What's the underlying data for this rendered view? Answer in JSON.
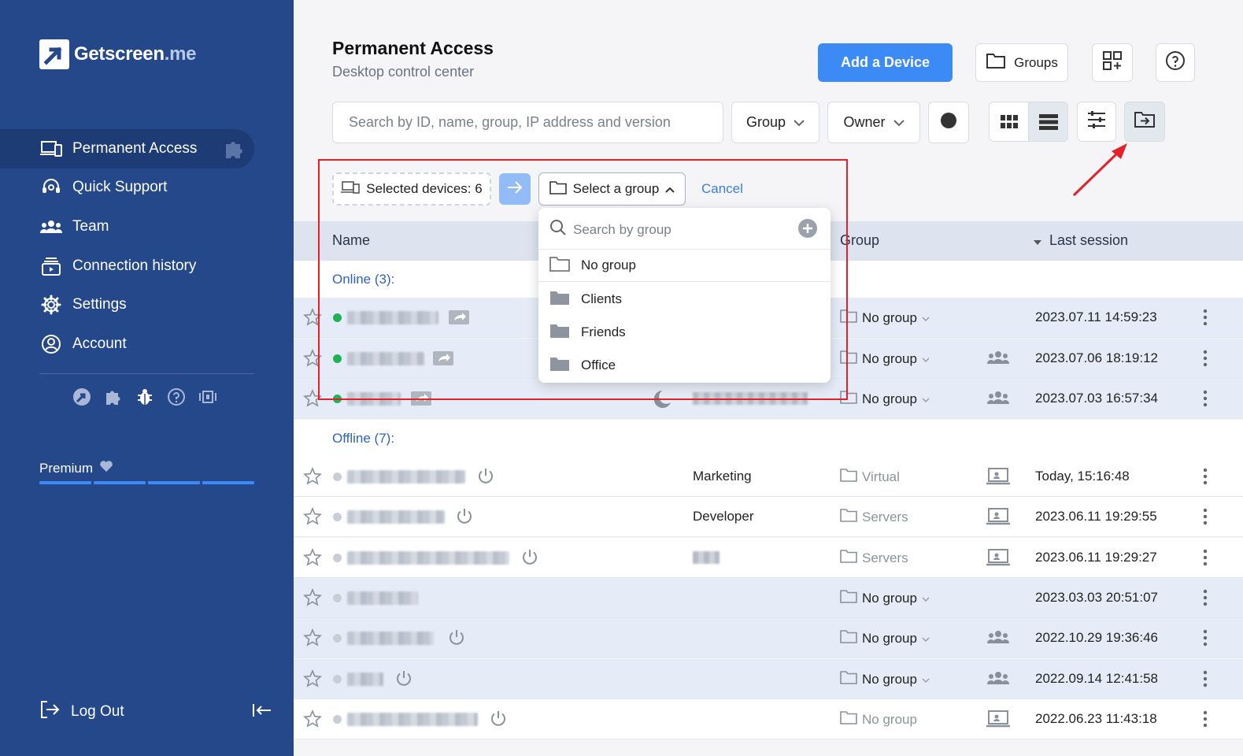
{
  "brand": {
    "name": "Getscreen",
    "suffix": ".me"
  },
  "sidebar": {
    "items": [
      {
        "label": "Permanent Access",
        "icon": "devices-icon",
        "active": true
      },
      {
        "label": "Quick Support",
        "icon": "headset-icon"
      },
      {
        "label": "Team",
        "icon": "team-icon"
      },
      {
        "label": "Connection history",
        "icon": "history-icon"
      },
      {
        "label": "Settings",
        "icon": "gear-icon"
      },
      {
        "label": "Account",
        "icon": "account-icon"
      }
    ],
    "tools": [
      "app-logo-icon",
      "puzzle-icon",
      "bug-icon",
      "help-circle-icon",
      "flag-icon"
    ],
    "plan": "Premium",
    "logout": "Log Out"
  },
  "header": {
    "title": "Permanent Access",
    "subtitle": "Desktop control center",
    "add_device": "Add a Device",
    "groups": "Groups"
  },
  "filters": {
    "search_placeholder": "Search by ID, name, group, IP address and version",
    "group": "Group",
    "owner": "Owner"
  },
  "selection": {
    "count_label": "Selected devices: 6",
    "select_group": "Select a group",
    "cancel": "Cancel"
  },
  "group_popup": {
    "search_placeholder": "Search by group",
    "items": [
      "No group",
      "Clients",
      "Friends",
      "Office"
    ]
  },
  "table": {
    "columns": {
      "name": "Name",
      "group": "Group",
      "last_session": "Last session"
    },
    "online_label": "Online (3):",
    "offline_label": "Offline (7):",
    "online_rows": [
      {
        "group": "No group",
        "last": "2023.07.11 14:59:23"
      },
      {
        "group": "No group",
        "last": "2023.07.06 18:19:12"
      },
      {
        "group": "No group",
        "last": "2023.07.03 16:57:34"
      }
    ],
    "offline_rows": [
      {
        "owner": "Marketing",
        "group": "Virtual",
        "last": "Today, 15:16:48"
      },
      {
        "owner": "Developer",
        "group": "Servers",
        "last": "2023.06.11 19:29:55"
      },
      {
        "owner": "",
        "group": "Servers",
        "last": "2023.06.11 19:29:27"
      },
      {
        "owner": "",
        "group": "No group",
        "last": "2023.03.03 20:51:07"
      },
      {
        "owner": "",
        "group": "No group",
        "last": "2022.10.29 19:36:46"
      },
      {
        "owner": "",
        "group": "No group",
        "last": "2022.09.14 12:41:58"
      },
      {
        "owner": "",
        "group": "No group",
        "last": "2022.06.23 11:43:18"
      }
    ]
  },
  "colors": {
    "sidebar": "#24488a",
    "accent": "#3b8af5",
    "online": "#1fb356",
    "highlight": "#e5202a"
  }
}
